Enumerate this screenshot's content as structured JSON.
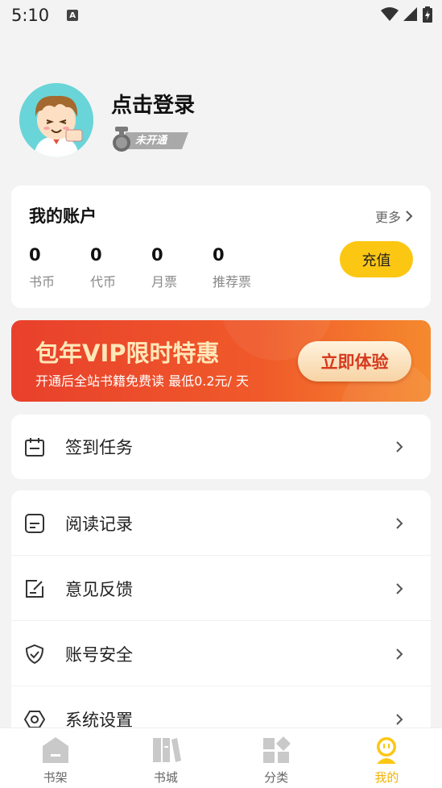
{
  "status_bar": {
    "time": "5:10",
    "notif_letter": "A"
  },
  "profile": {
    "login_label": "点击登录",
    "vip_badge": "未开通"
  },
  "account": {
    "title": "我的账户",
    "more_label": "更多",
    "stats": [
      {
        "value": "0",
        "label": "书币"
      },
      {
        "value": "0",
        "label": "代币"
      },
      {
        "value": "0",
        "label": "月票"
      },
      {
        "value": "0",
        "label": "推荐票"
      }
    ],
    "recharge_label": "充值"
  },
  "vip_banner": {
    "title": "包年VIP限时特惠",
    "subtitle": "开通后全站书籍免费读 最低0.2元/ 天",
    "button_label": "立即体验"
  },
  "menu": {
    "checkin": "签到任务",
    "reading_history": "阅读记录",
    "feedback": "意见反馈",
    "account_security": "账号安全",
    "settings": "系统设置"
  },
  "bottom_nav": {
    "bookshelf": "书架",
    "bookstore": "书城",
    "category": "分类",
    "mine": "我的"
  },
  "colors": {
    "accent": "#fcc713",
    "active_tab": "#f2b300",
    "banner_red": "#e8402c"
  }
}
